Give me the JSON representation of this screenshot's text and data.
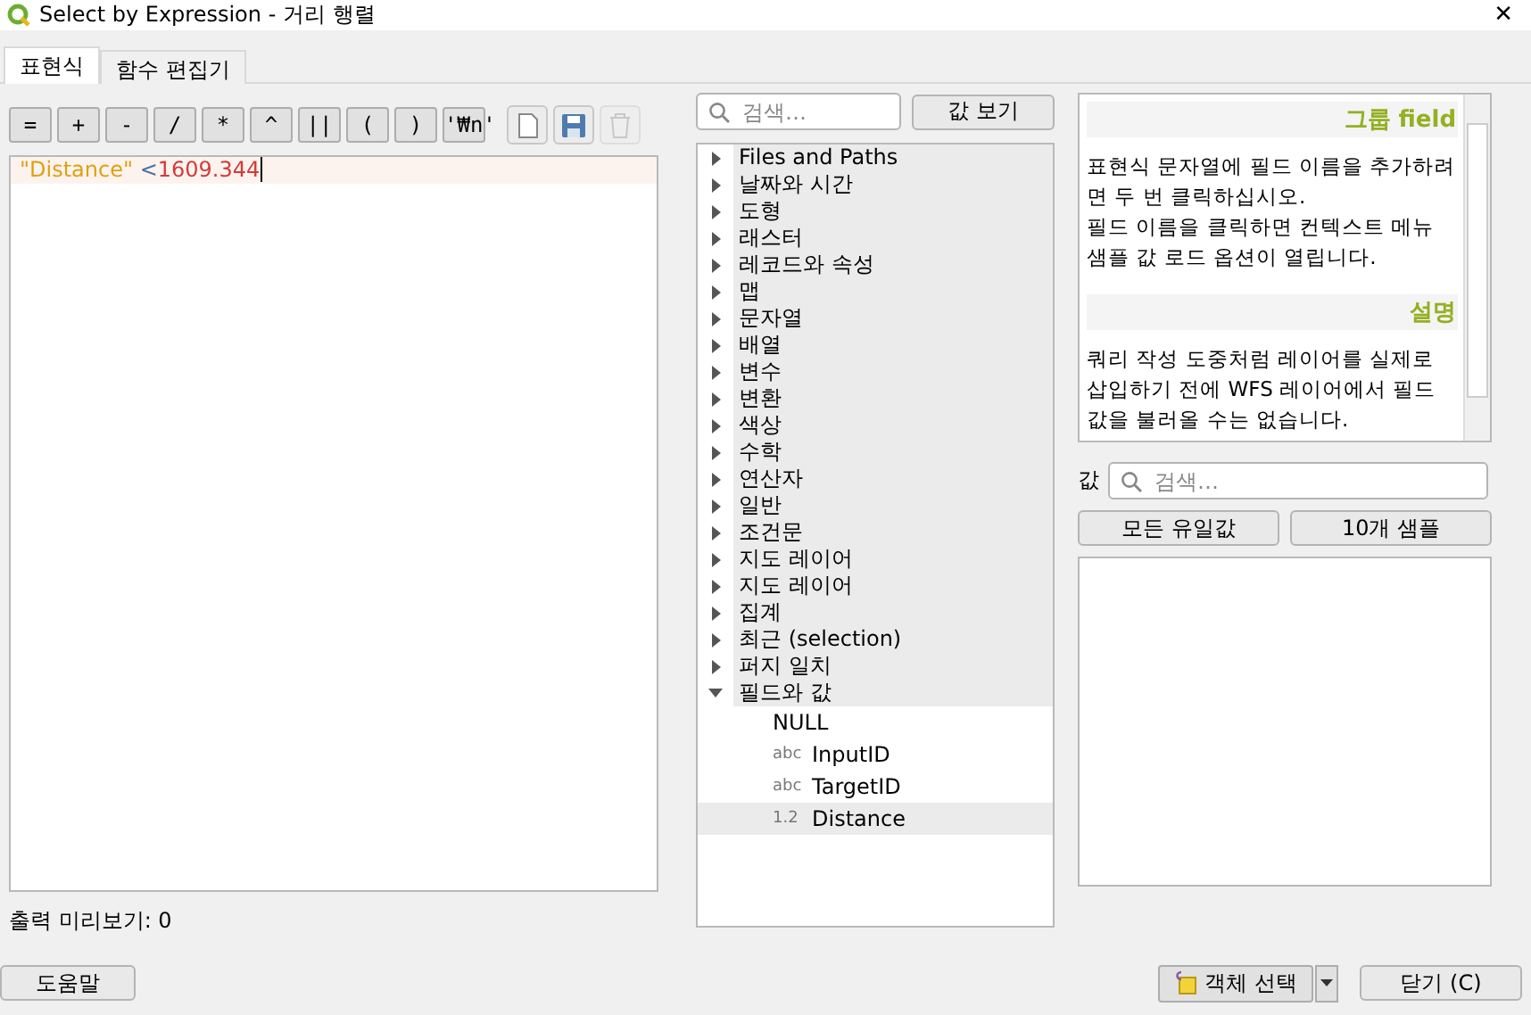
{
  "window": {
    "title": "Select by Expression - 거리 행렬",
    "close": "✕"
  },
  "tabs": [
    {
      "label": "표현식",
      "selected": true
    },
    {
      "label": "함수 편집기",
      "selected": false
    }
  ],
  "operators": [
    "=",
    "+",
    "-",
    "/",
    "*",
    "^",
    "||",
    "(",
    ")",
    "'₩n'"
  ],
  "file_tools": [
    {
      "kind": "new",
      "disabled": false
    },
    {
      "kind": "save",
      "disabled": false
    },
    {
      "kind": "delete",
      "disabled": true
    }
  ],
  "expression": [
    {
      "kind": "field",
      "text": "\"Distance\""
    },
    {
      "kind": "operator",
      "text": " <"
    },
    {
      "kind": "number",
      "text": "1609.344"
    }
  ],
  "output_preview": "출력 미리보기: 0",
  "function_search": {
    "placeholder": "검색…"
  },
  "show_values_button": "값 보기",
  "tree": [
    {
      "label": "Files and Paths",
      "expanded": false
    },
    {
      "label": "날짜와 시간",
      "expanded": false
    },
    {
      "label": "도형",
      "expanded": false
    },
    {
      "label": "래스터",
      "expanded": false
    },
    {
      "label": "레코드와 속성",
      "expanded": false
    },
    {
      "label": "맵",
      "expanded": false
    },
    {
      "label": "문자열",
      "expanded": false
    },
    {
      "label": "배열",
      "expanded": false
    },
    {
      "label": "변수",
      "expanded": false
    },
    {
      "label": "변환",
      "expanded": false
    },
    {
      "label": "색상",
      "expanded": false
    },
    {
      "label": "수학",
      "expanded": false
    },
    {
      "label": "연산자",
      "expanded": false
    },
    {
      "label": "일반",
      "expanded": false
    },
    {
      "label": "조건문",
      "expanded": false
    },
    {
      "label": "지도 레이어",
      "expanded": false
    },
    {
      "label": "지도 레이어",
      "expanded": false
    },
    {
      "label": "집계",
      "expanded": false
    },
    {
      "label": "최근 (selection)",
      "expanded": false
    },
    {
      "label": "퍼지 일치",
      "expanded": false
    },
    {
      "label": "필드와 값",
      "expanded": true,
      "children": [
        {
          "label": "NULL",
          "selected": false
        },
        {
          "type": "abc",
          "label": "InputID",
          "selected": false
        },
        {
          "type": "abc",
          "label": "TargetID",
          "selected": false
        },
        {
          "type": "1.2",
          "label": "Distance",
          "selected": true
        }
      ]
    }
  ],
  "help": [
    {
      "heading": "그룹 **field**",
      "paragraphs": [
        "표현식 문자열에 필드 이름을 추가하려면 두 번 클릭하십시오.",
        "필드 이름을 클릭하면 컨텍스트 메뉴 샘플 값 로드 옵션이 열립니다."
      ]
    },
    {
      "heading": "설명",
      "paragraphs": [
        "쿼리 작성 도중처럼 레이어를 실제로 삽입하기 전에 WFS 레이어에서 필드 값을 불러올 수는 없습니다."
      ]
    }
  ],
  "values": {
    "label": "값",
    "placeholder": "검색…",
    "buttons": [
      "모든 유일값",
      "10개 샘플"
    ]
  },
  "bottom": {
    "help": "도움말",
    "select": "객체 선택",
    "close": "닫기 (C)"
  }
}
